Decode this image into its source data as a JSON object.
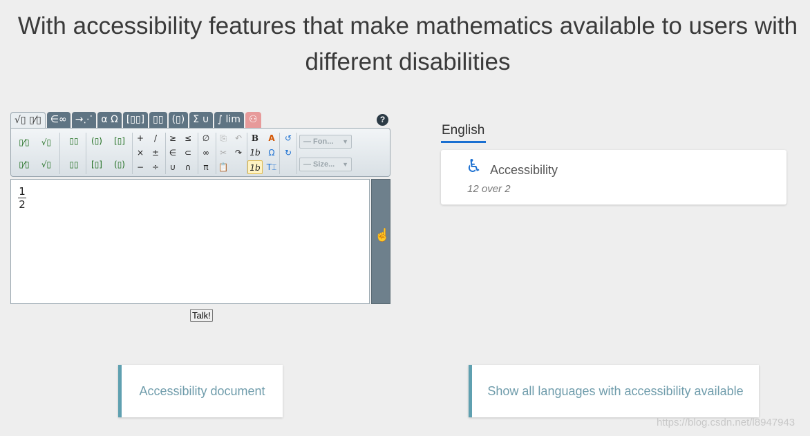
{
  "heading": "With accessibility features that make mathematics available to users with different disabilities",
  "editor": {
    "tabs": [
      "√▯ ▯⁄▯",
      "∈∞",
      "→⋰",
      "α Ω",
      "[▯▯]",
      "▯▯",
      "(▯)",
      "Σ ∪",
      "∫ lim",
      "⚇"
    ],
    "help_label": "?",
    "toolbar": {
      "fraction": "▯⁄▯",
      "sqrt": "√▯",
      "power": "▯▯",
      "parens": "(▯)",
      "brackets": "[▯]",
      "plus": "+",
      "slash": "/",
      "geq": "≥",
      "leq": "≤",
      "emptyset": "∅",
      "times": "×",
      "plusminus": "±",
      "in": "∈",
      "subset": "⊂",
      "infinity": "∞",
      "minus": "−",
      "divide": "÷",
      "union": "∪",
      "intersect": "∩",
      "pi": "π",
      "bold": "B",
      "italic": "1b",
      "font_placeholder": "— Fon...",
      "size_placeholder": "— Size..."
    },
    "content": {
      "numerator": "1",
      "denominator": "2"
    },
    "talk_label": "Talk!"
  },
  "panel": {
    "language_tab": "English",
    "card_title": "Accessibility",
    "card_subtitle": "12 over 2"
  },
  "buttons": {
    "doc": "Accessibility document",
    "languages": "Show all languages with accessibility available"
  },
  "watermark": "https://blog.csdn.net/l8947943",
  "colors": {
    "accent": "#1a6fd1",
    "tab": "#5f7483",
    "button_border": "#5fa0b0"
  }
}
